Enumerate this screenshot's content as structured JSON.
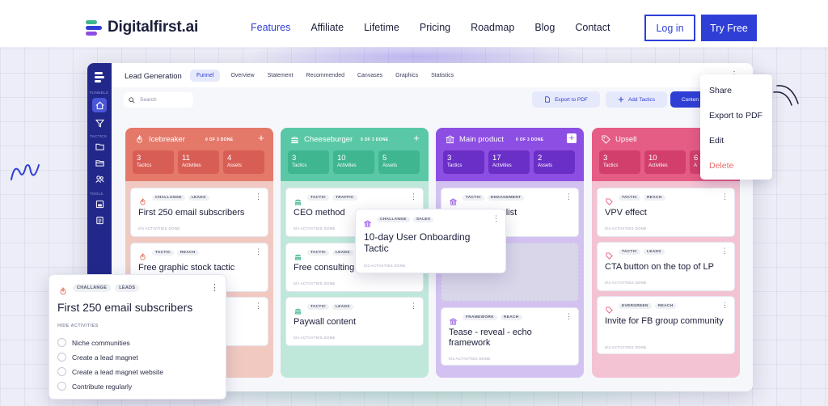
{
  "brand": {
    "name": "Digitalfirst.ai"
  },
  "nav": {
    "links": [
      "Features",
      "Affiliate",
      "Lifetime",
      "Pricing",
      "Roadmap",
      "Blog",
      "Contact"
    ],
    "active": "Features",
    "login": "Log in",
    "try": "Try Free"
  },
  "app": {
    "title": "Lead Generation",
    "tabs": [
      "Funnel",
      "Overview",
      "Statement",
      "Recommended",
      "Canvases",
      "Graphics",
      "Statistics"
    ],
    "active_tab": "Funnel",
    "sidebar": {
      "section1": "FUNNELS",
      "section2": "TACTICS",
      "section3": "TOOLS"
    },
    "search_placeholder": "Search",
    "toolbar": {
      "export": "Export to PDF",
      "add": "Add Tactics",
      "content": "Conten"
    }
  },
  "menu": {
    "items": [
      "Share",
      "Export to PDF",
      "Edit",
      "Delete"
    ]
  },
  "columns": [
    {
      "title": "Icebreaker",
      "done": "0 OF 3 DONE",
      "color": "#e4796a",
      "stat_color": "#d85e55",
      "bg": "#f1c9c1",
      "stats": [
        {
          "n": "3",
          "l": "Tactics"
        },
        {
          "n": "11",
          "l": "Activities"
        },
        {
          "n": "4",
          "l": "Assets"
        }
      ],
      "cards": [
        {
          "tags": [
            "CHALLANGE",
            "LEADS"
          ],
          "title": "First 250 email subscribers",
          "sub": "0/4 ACTIVITIES DONE"
        },
        {
          "tags": [
            "TACTIC",
            "REACH"
          ],
          "title": "Free graphic stock tactic",
          "sub": ""
        },
        {
          "tags": [],
          "title": "",
          "sub": ""
        }
      ]
    },
    {
      "title": "Cheeseburger",
      "done": "0 OF 3 DONE",
      "color": "#5ac8a6",
      "stat_color": "#3fb690",
      "bg": "#bfe7da",
      "stats": [
        {
          "n": "3",
          "l": "Tactics"
        },
        {
          "n": "10",
          "l": "Activities"
        },
        {
          "n": "5",
          "l": "Assets"
        }
      ],
      "cards": [
        {
          "tags": [
            "TACTIC",
            "TRAFFIC"
          ],
          "title": "CEO method",
          "sub": "0/3 ACTIVITIES DONE"
        },
        {
          "tags": [
            "TACTIC",
            "LEADS"
          ],
          "title": "Free consulting",
          "sub": "0/3 ACTIVITIES DONE"
        },
        {
          "tags": [
            "TACTIC",
            "LEADS"
          ],
          "title": "Paywall content",
          "sub": "0/4 ACTIVITIES DONE"
        }
      ]
    },
    {
      "title": "Main product",
      "done": "0 OF 3 DONE",
      "color": "#8d4ee3",
      "stat_color": "#6a2fc7",
      "bg": "#d3c2f1",
      "stats": [
        {
          "n": "3",
          "l": "Tactics"
        },
        {
          "n": "17",
          "l": "Activities"
        },
        {
          "n": "2",
          "l": "Assets"
        }
      ],
      "cards": [
        {
          "tags": [
            "TACTIC",
            "ENGAGEMENT"
          ],
          "title": "r list",
          "sub": ""
        },
        {
          "tags": [
            "FRAMEWORK",
            "REACH"
          ],
          "title": "Tease - reveal - echo framework",
          "sub": "0/3 ACTIVITIES DONE"
        }
      ]
    },
    {
      "title": "Upsell",
      "done": "",
      "color": "#e55c85",
      "stat_color": "#d23f6d",
      "bg": "#f3c3d3",
      "stats": [
        {
          "n": "3",
          "l": "Tactics"
        },
        {
          "n": "10",
          "l": "Activities"
        },
        {
          "n": "6",
          "l": "A"
        }
      ],
      "cards": [
        {
          "tags": [
            "TACTIC",
            "REACH"
          ],
          "title": "VPV effect",
          "sub": "0/4 ACTIVITIES DONE"
        },
        {
          "tags": [
            "TACTIC",
            "LEADS"
          ],
          "title": "CTA button on the top of LP",
          "sub": "0/4 ACTIVITIES DONE"
        },
        {
          "tags": [
            "EVERGREEN",
            "REACH"
          ],
          "title": "Invite for FB group community",
          "sub": "0/3 ACTIVITIES DONE"
        }
      ]
    }
  ],
  "dragged": {
    "tags": [
      "CHALLANGE",
      "SALES"
    ],
    "title": "10-day User Onboarding Tactic",
    "sub": "0/3 ACTIVITIES DONE"
  },
  "expanded": {
    "tags": [
      "CHALLANGE",
      "LEADS"
    ],
    "title": "First 250 email subscribers",
    "hide": "HIDE ACTIVITIES",
    "activities": [
      "Niche communities",
      "Create a lead magnet",
      "Create a lead magnet website",
      "Contribute regularly"
    ]
  }
}
